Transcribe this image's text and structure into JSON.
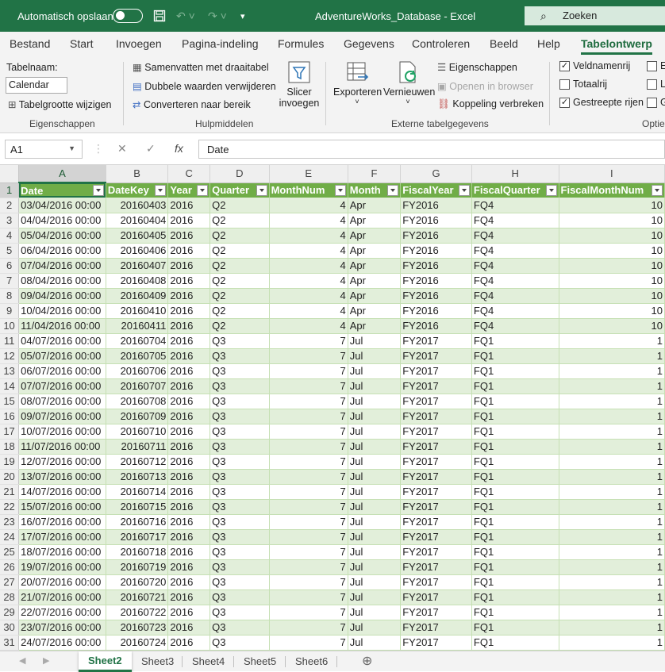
{
  "titlebar": {
    "autosave_label": "Automatisch opslaan",
    "title": "AdventureWorks_Database  -  Excel",
    "search_label": "Zoeken"
  },
  "tabs": [
    "Bestand",
    "Start",
    "Invoegen",
    "Pagina-indeling",
    "Formules",
    "Gegevens",
    "Controleren",
    "Beeld",
    "Help",
    "Tabelontwerp"
  ],
  "ribbon": {
    "tablename_label": "Tabelnaam:",
    "tablename_value": "Calendar",
    "resize_label": "Tabelgrootte wijzigen",
    "group_properties": "Eigenschappen",
    "pivot_label": "Samenvatten met draaitabel",
    "dedupe_label": "Dubbele waarden verwijderen",
    "convert_label": "Converteren naar bereik",
    "slicer_label_1": "Slicer",
    "slicer_label_2": "invoegen",
    "group_tools": "Hulpmiddelen",
    "export_label": "Exporteren",
    "refresh_label": "Vernieuwen",
    "props_label": "Eigenschappen",
    "open_browser_label": "Openen in browser",
    "unlink_label": "Koppeling verbreken",
    "group_external": "Externe tabelgegevens",
    "header_row_label": "Veldnamenrij",
    "total_row_label": "Totaalrij",
    "banded_rows_label": "Gestreepte rijen",
    "group_style": "Optie",
    "partial_1": "E",
    "partial_2": "L",
    "partial_3": "G"
  },
  "formula": {
    "namebox": "A1",
    "value": "Date"
  },
  "columns": [
    "A",
    "B",
    "C",
    "D",
    "E",
    "F",
    "G",
    "H",
    "I"
  ],
  "headers": [
    "Date",
    "DateKey",
    "Year",
    "Quarter",
    "MonthNum",
    "Month",
    "FiscalYear",
    "FiscalQuarter",
    "FiscalMonthNum"
  ],
  "rows": [
    [
      "03/04/2016 00:00",
      "20160403",
      "2016",
      "Q2",
      "4",
      "Apr",
      "FY2016",
      "FQ4",
      "10"
    ],
    [
      "04/04/2016 00:00",
      "20160404",
      "2016",
      "Q2",
      "4",
      "Apr",
      "FY2016",
      "FQ4",
      "10"
    ],
    [
      "05/04/2016 00:00",
      "20160405",
      "2016",
      "Q2",
      "4",
      "Apr",
      "FY2016",
      "FQ4",
      "10"
    ],
    [
      "06/04/2016 00:00",
      "20160406",
      "2016",
      "Q2",
      "4",
      "Apr",
      "FY2016",
      "FQ4",
      "10"
    ],
    [
      "07/04/2016 00:00",
      "20160407",
      "2016",
      "Q2",
      "4",
      "Apr",
      "FY2016",
      "FQ4",
      "10"
    ],
    [
      "08/04/2016 00:00",
      "20160408",
      "2016",
      "Q2",
      "4",
      "Apr",
      "FY2016",
      "FQ4",
      "10"
    ],
    [
      "09/04/2016 00:00",
      "20160409",
      "2016",
      "Q2",
      "4",
      "Apr",
      "FY2016",
      "FQ4",
      "10"
    ],
    [
      "10/04/2016 00:00",
      "20160410",
      "2016",
      "Q2",
      "4",
      "Apr",
      "FY2016",
      "FQ4",
      "10"
    ],
    [
      "11/04/2016 00:00",
      "20160411",
      "2016",
      "Q2",
      "4",
      "Apr",
      "FY2016",
      "FQ4",
      "10"
    ],
    [
      "04/07/2016 00:00",
      "20160704",
      "2016",
      "Q3",
      "7",
      "Jul",
      "FY2017",
      "FQ1",
      "1"
    ],
    [
      "05/07/2016 00:00",
      "20160705",
      "2016",
      "Q3",
      "7",
      "Jul",
      "FY2017",
      "FQ1",
      "1"
    ],
    [
      "06/07/2016 00:00",
      "20160706",
      "2016",
      "Q3",
      "7",
      "Jul",
      "FY2017",
      "FQ1",
      "1"
    ],
    [
      "07/07/2016 00:00",
      "20160707",
      "2016",
      "Q3",
      "7",
      "Jul",
      "FY2017",
      "FQ1",
      "1"
    ],
    [
      "08/07/2016 00:00",
      "20160708",
      "2016",
      "Q3",
      "7",
      "Jul",
      "FY2017",
      "FQ1",
      "1"
    ],
    [
      "09/07/2016 00:00",
      "20160709",
      "2016",
      "Q3",
      "7",
      "Jul",
      "FY2017",
      "FQ1",
      "1"
    ],
    [
      "10/07/2016 00:00",
      "20160710",
      "2016",
      "Q3",
      "7",
      "Jul",
      "FY2017",
      "FQ1",
      "1"
    ],
    [
      "11/07/2016 00:00",
      "20160711",
      "2016",
      "Q3",
      "7",
      "Jul",
      "FY2017",
      "FQ1",
      "1"
    ],
    [
      "12/07/2016 00:00",
      "20160712",
      "2016",
      "Q3",
      "7",
      "Jul",
      "FY2017",
      "FQ1",
      "1"
    ],
    [
      "13/07/2016 00:00",
      "20160713",
      "2016",
      "Q3",
      "7",
      "Jul",
      "FY2017",
      "FQ1",
      "1"
    ],
    [
      "14/07/2016 00:00",
      "20160714",
      "2016",
      "Q3",
      "7",
      "Jul",
      "FY2017",
      "FQ1",
      "1"
    ],
    [
      "15/07/2016 00:00",
      "20160715",
      "2016",
      "Q3",
      "7",
      "Jul",
      "FY2017",
      "FQ1",
      "1"
    ],
    [
      "16/07/2016 00:00",
      "20160716",
      "2016",
      "Q3",
      "7",
      "Jul",
      "FY2017",
      "FQ1",
      "1"
    ],
    [
      "17/07/2016 00:00",
      "20160717",
      "2016",
      "Q3",
      "7",
      "Jul",
      "FY2017",
      "FQ1",
      "1"
    ],
    [
      "18/07/2016 00:00",
      "20160718",
      "2016",
      "Q3",
      "7",
      "Jul",
      "FY2017",
      "FQ1",
      "1"
    ],
    [
      "19/07/2016 00:00",
      "20160719",
      "2016",
      "Q3",
      "7",
      "Jul",
      "FY2017",
      "FQ1",
      "1"
    ],
    [
      "20/07/2016 00:00",
      "20160720",
      "2016",
      "Q3",
      "7",
      "Jul",
      "FY2017",
      "FQ1",
      "1"
    ],
    [
      "21/07/2016 00:00",
      "20160721",
      "2016",
      "Q3",
      "7",
      "Jul",
      "FY2017",
      "FQ1",
      "1"
    ],
    [
      "22/07/2016 00:00",
      "20160722",
      "2016",
      "Q3",
      "7",
      "Jul",
      "FY2017",
      "FQ1",
      "1"
    ],
    [
      "23/07/2016 00:00",
      "20160723",
      "2016",
      "Q3",
      "7",
      "Jul",
      "FY2017",
      "FQ1",
      "1"
    ],
    [
      "24/07/2016 00:00",
      "20160724",
      "2016",
      "Q3",
      "7",
      "Jul",
      "FY2017",
      "FQ1",
      "1"
    ]
  ],
  "sheets": [
    "Sheet2",
    "Sheet3",
    "Sheet4",
    "Sheet5",
    "Sheet6"
  ],
  "colors": {
    "accent": "#217346",
    "header_fill": "#70ad47",
    "band_fill": "#e2efda"
  }
}
